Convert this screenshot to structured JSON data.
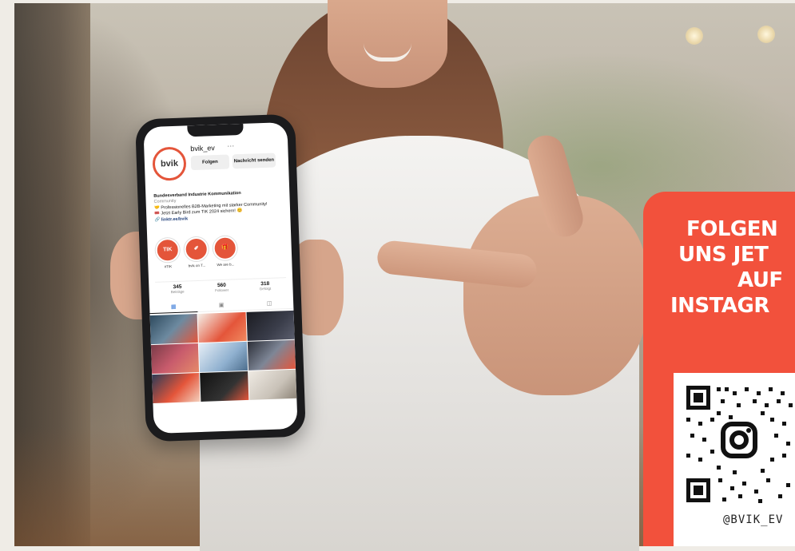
{
  "profile": {
    "avatar_text": "bvik",
    "username": "bvik_ev",
    "more": "···",
    "follow_button": "Folgen",
    "message_button": "Nachricht senden",
    "bio": {
      "name": "Bundesverband Industrie Kommunikation",
      "category": "Community",
      "line1": "🤝 Professionelles B2B-Marketing mit starker Community!",
      "line2": "🎟️ Jetzt Early Bird zum TIK 2024 sichern! 😊",
      "link": "🔗 linktr.ee/bvik"
    },
    "highlights": [
      {
        "icon": "TIK",
        "label": "#TIK"
      },
      {
        "icon": "✐",
        "label": "bvik on T..."
      },
      {
        "icon": "🎁",
        "label": "We are b..."
      }
    ],
    "stats": [
      {
        "value": "345",
        "label": "Beiträge"
      },
      {
        "value": "560",
        "label": "Follower"
      },
      {
        "value": "318",
        "label": "Gefolgt"
      }
    ],
    "tabs": [
      {
        "icon": "grid-icon",
        "glyph": "▦"
      },
      {
        "icon": "reels-icon",
        "glyph": "▣"
      },
      {
        "icon": "tagged-icon",
        "glyph": "◫"
      }
    ]
  },
  "promo": {
    "line1": "FOLGEN",
    "line2": "UNS JET",
    "line3": "AUF",
    "line4": "INSTAGR",
    "handle": "@BVIK_EV",
    "accent": "#f2513c"
  }
}
